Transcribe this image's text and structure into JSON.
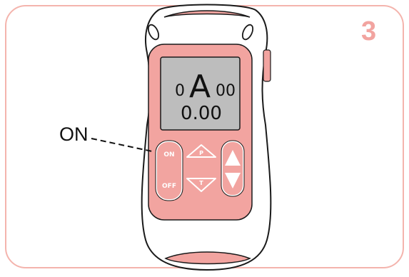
{
  "step_number": "3",
  "callout": {
    "label": "ON"
  },
  "device": {
    "display": {
      "mode_prefix": "0",
      "mode_letter": "A",
      "mode_suffix": "00",
      "value": "0.00"
    },
    "buttons": {
      "power_on": "ON",
      "power_off": "OFF",
      "program_up": "P",
      "time_down": "T"
    }
  },
  "colors": {
    "accent": "#f2a4a0",
    "frame_border": "#f4b4ad",
    "lcd_background": "#bdbdbd",
    "outline": "#1a1a1a"
  }
}
